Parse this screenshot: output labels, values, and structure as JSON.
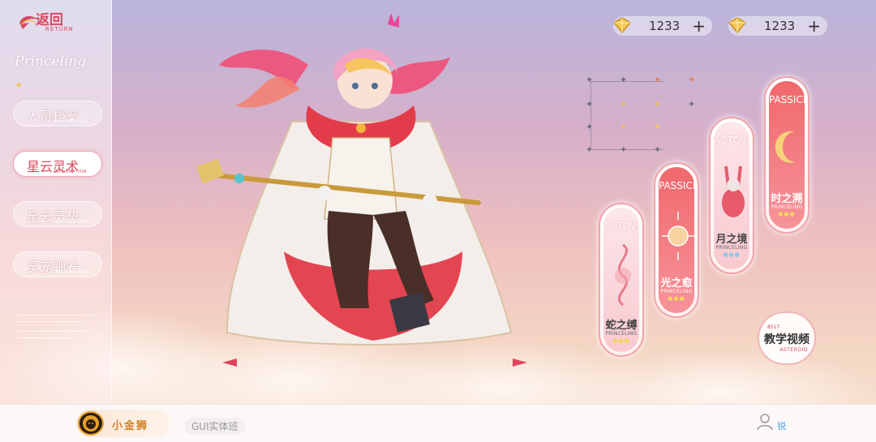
{
  "nav": {
    "back_label": "返回",
    "back_sub": "RETURN",
    "brand_script": "Princeling",
    "items": [
      {
        "label": "人员档案",
        "sub": "INFORMATION",
        "active": false
      },
      {
        "label": "星云灵术",
        "sub": "INFORMATION",
        "active": true
      },
      {
        "label": "星云灵契",
        "sub": "INFORMATION",
        "active": false
      },
      {
        "label": "灵宠驯养",
        "sub": "INFORMATION",
        "active": false
      }
    ]
  },
  "currency": [
    {
      "icon": "gold-gem-icon",
      "value": "1233",
      "plus": "+"
    },
    {
      "icon": "gold-gem-icon",
      "value": "1233",
      "plus": "+"
    }
  ],
  "cards": [
    {
      "type": "ACTOVE",
      "name": "蛇之缚",
      "sub": "PRINCELING",
      "style": "pale"
    },
    {
      "type": "PASSICE",
      "name": "光之愈",
      "sub": "PRINCELING",
      "style": "red"
    },
    {
      "type": "ACTOVE",
      "name": "月之境",
      "sub": "PRINCELING",
      "style": "pale"
    },
    {
      "type": "PASSICE",
      "name": "时之溯",
      "sub": "PRINCELING",
      "style": "red"
    }
  ],
  "tutorial": {
    "small": "8517",
    "label": "教学视频",
    "sub": "ASTEROID"
  },
  "footer": {
    "brand": "小金狮",
    "course": "GUI实体班",
    "user_label": "锐"
  },
  "colors": {
    "accent": "#d84a5e",
    "card_red": "#f0686c",
    "gold": "#f0c35a"
  }
}
